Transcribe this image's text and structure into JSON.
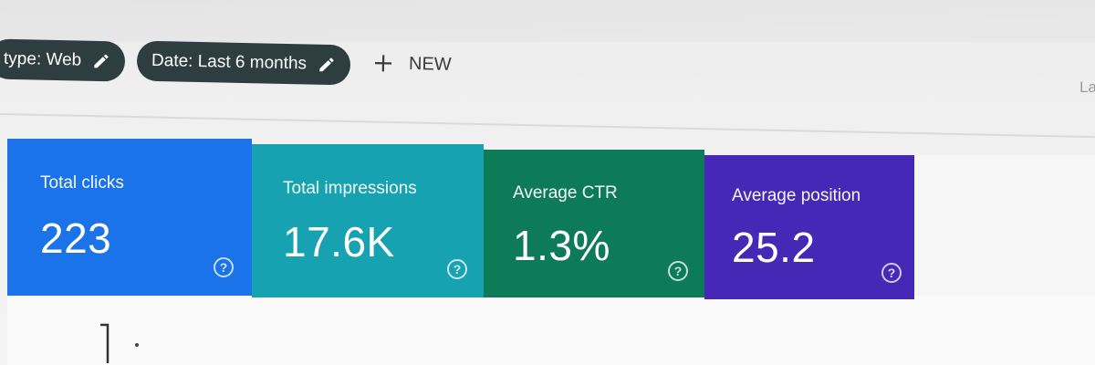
{
  "filters": {
    "type_chip": "type: Web",
    "date_chip": "Date: Last 6 months",
    "new_label": "NEW"
  },
  "edge_text": "La",
  "metrics": [
    {
      "label": "Total clicks",
      "value": "223",
      "color": "#1a73e8"
    },
    {
      "label": "Total impressions",
      "value": "17.6K",
      "color": "#16a2b0"
    },
    {
      "label": "Average CTR",
      "value": "1.3%",
      "color": "#0e7b58"
    },
    {
      "label": "Average position",
      "value": "25.2",
      "color": "#4528b5"
    }
  ],
  "icons": {
    "edit": "pencil-icon",
    "add": "plus-icon",
    "help": "help-circle-icon"
  }
}
